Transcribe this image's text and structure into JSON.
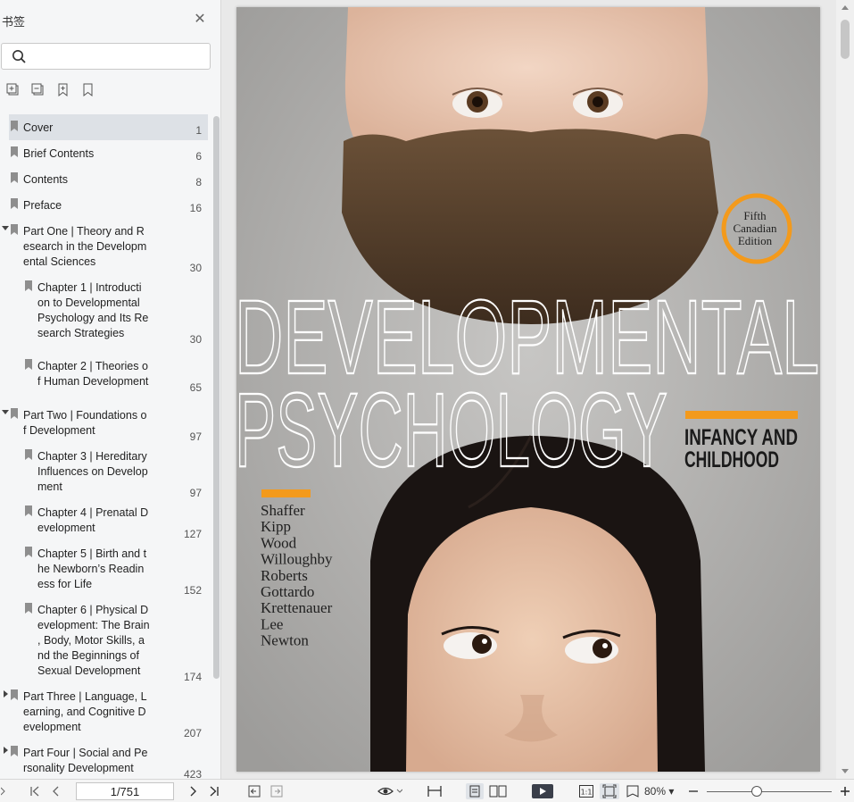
{
  "sidebar": {
    "title": "书签",
    "search_placeholder": "",
    "bookmarks": [
      {
        "label": "Cover",
        "page": "1",
        "level": 0,
        "selected": true
      },
      {
        "label": "Brief Contents",
        "page": "6",
        "level": 0
      },
      {
        "label": "Contents",
        "page": "8",
        "level": 0
      },
      {
        "label": "Preface",
        "page": "16",
        "level": 0
      },
      {
        "label": "Part One | Theory and R\nesearch in the Developm\nental Sciences",
        "page": "30",
        "level": 0,
        "expand": "open"
      },
      {
        "label": "Chapter 1 | Introducti\non to Developmental\nPsychology and Its Re\nsearch Strategies",
        "page": "30",
        "level": 1
      },
      {
        "label": "Chapter 2 | Theories o\nf Human Development",
        "page": "65",
        "level": 1
      },
      {
        "label": "Part Two | Foundations o\nf Development",
        "page": "97",
        "level": 0,
        "expand": "open"
      },
      {
        "label": "Chapter 3 | Hereditary\nInfluences on Develop\nment",
        "page": "97",
        "level": 1
      },
      {
        "label": "Chapter 4 | Prenatal D\nevelopment",
        "page": "127",
        "level": 1
      },
      {
        "label": "Chapter 5 | Birth and t\nhe Newborn’s Readin\ness for Life",
        "page": "152",
        "level": 1
      },
      {
        "label": "Chapter 6 | Physical D\nevelopment: The Brain\n, Body, Motor Skills, a\nnd the Beginnings of\nSexual Development",
        "page": "174",
        "level": 1
      },
      {
        "label": "Part Three | Language, L\nearning, and Cognitive D\nevelopment",
        "page": "207",
        "level": 0,
        "expand": "closed"
      },
      {
        "label": "Part Four | Social and Pe\nrsonality Development",
        "page": "423",
        "level": 0,
        "expand": "closed"
      }
    ]
  },
  "cover": {
    "badge_line1": "Fifth",
    "badge_line2": "Canadian",
    "badge_line3": "Edition",
    "title_line1": "DEVELOPMENTAL",
    "title_line2": "PSYCHOLOGY",
    "subtitle_line1": "INFANCY AND",
    "subtitle_line2": "CHILDHOOD",
    "authors": [
      "Shaffer",
      "Kipp",
      "Wood",
      "Willoughby",
      "Roberts",
      "Gottardo",
      "Krettenauer",
      "Lee",
      "Newton"
    ],
    "accent_color": "#f39a1c"
  },
  "toolbar": {
    "page_value": "1/751",
    "zoom": "80%"
  }
}
